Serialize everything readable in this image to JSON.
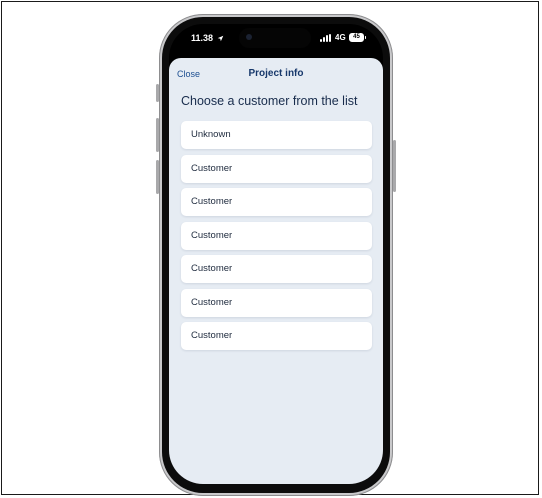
{
  "status": {
    "time": "11.38",
    "network": "4G",
    "battery": "45"
  },
  "header": {
    "close_label": "Close",
    "title": "Project info"
  },
  "heading": "Choose a customer from the list",
  "customers": [
    "Unknown",
    "Customer",
    "Customer",
    "Customer",
    "Customer",
    "Customer",
    "Customer"
  ],
  "colors": {
    "accent": "#17386b",
    "link": "#1d4f91",
    "sheet_bg": "#e6ecf3"
  },
  "icons": [
    "location-arrow-icon",
    "signal-icon",
    "battery-icon"
  ]
}
